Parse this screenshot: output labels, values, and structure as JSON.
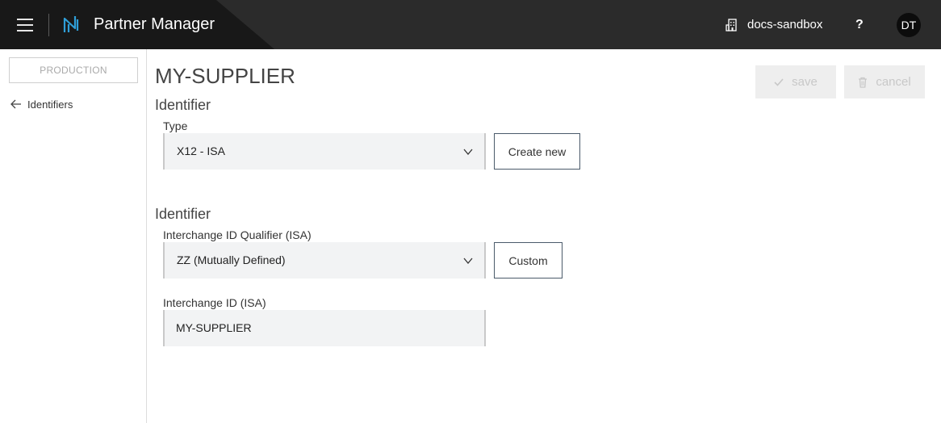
{
  "header": {
    "menu_icon": "hamburger-icon",
    "logo_icon": "partner-manager-logo",
    "app_title": "Partner Manager",
    "environment_icon": "building-icon",
    "environment_name": "docs-sandbox",
    "help_label": "?",
    "avatar_initials": "DT"
  },
  "sidebar": {
    "environment_badge": "PRODUCTION",
    "back_link": {
      "icon": "arrow-left-icon",
      "label": "Identifiers"
    }
  },
  "main": {
    "page_title": "MY-SUPPLIER",
    "actions": {
      "save": {
        "icon": "check-icon",
        "label": "save",
        "disabled": true
      },
      "cancel": {
        "icon": "trash-icon",
        "label": "cancel",
        "disabled": true
      }
    },
    "identifier_type_section": {
      "title": "Identifier",
      "type_label": "Type",
      "type_value": "X12 - ISA",
      "create_new_label": "Create new"
    },
    "identifier_section": {
      "title": "Identifier",
      "qualifier_label": "Interchange ID Qualifier (ISA)",
      "qualifier_value": "ZZ (Mutually Defined)",
      "custom_label": "Custom",
      "id_label": "Interchange ID (ISA)",
      "id_value": "MY-SUPPLIER"
    }
  },
  "colors": {
    "header_bg": "#2b2b2b",
    "header_dark_panel": "#181818",
    "logo_accent": "#2f9fd8",
    "field_bg": "#f2f3f4",
    "disabled_button_bg": "#eeeeee"
  }
}
